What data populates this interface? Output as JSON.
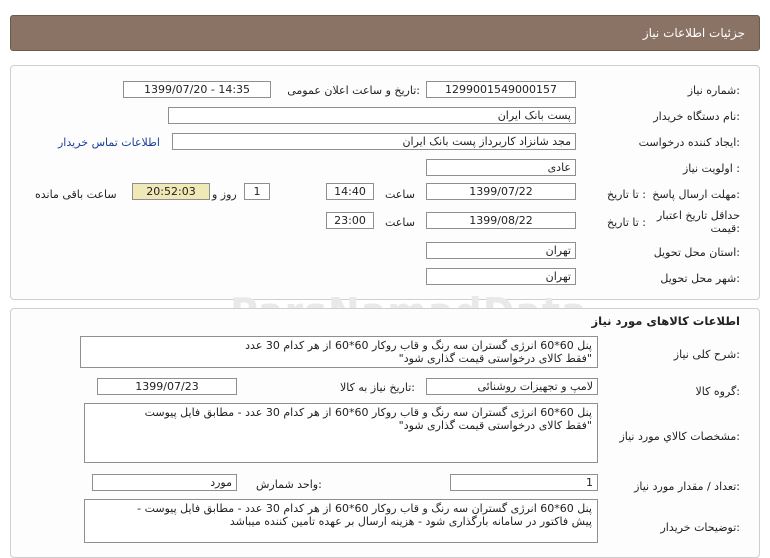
{
  "header": {
    "title": "جزئیات اطلاعات نیاز"
  },
  "watermark": "ParsNamadData",
  "info": {
    "need_number_label": "شماره نیاز:",
    "need_number": "1299001549000157",
    "announce_label": "تاریخ و ساعت اعلان عمومی:",
    "announce_value": "1399/07/20 - 14:35",
    "buyer_org_label": "نام دستگاه خریدار:",
    "buyer_org": "پست بانک ایران",
    "creator_label": "ایجاد کننده درخواست:",
    "creator": "مجد شانزاد کاربرداز پست بانک ایران",
    "contact_link": "اطلاعات تماس خریدار",
    "priority_label": "اولویت نیاز :",
    "priority": "عادی",
    "deadline_label": "مهلت ارسال پاسخ:",
    "until_date_label": "تا تاریخ :",
    "deadline_date": "1399/07/22",
    "time_label": "ساعت",
    "deadline_time": "14:40",
    "days": "1",
    "days_label": "روز و",
    "remaining": "20:52:03",
    "remaining_label": "ساعت باقی مانده",
    "price_valid_label": "حداقل تاریخ اعتبار قیمت:",
    "price_valid_date": "1399/08/22",
    "price_valid_time": "23:00",
    "province_label": "استان محل تحویل:",
    "province": "تهران",
    "city_label": "شهر محل تحویل:",
    "city": "تهران"
  },
  "goods": {
    "title": "اطلاعات کالاهای مورد نیاز",
    "summary_label": "شرح کلی نیاز:",
    "summary_line1": "پنل 60*60 انرژی گستران سه رنگ و قاب روکار 60*60 از هر کدام 30 عدد",
    "summary_line2": "\"فقط کالای درخواستی قیمت گذاری شود\"",
    "group_label": "گروه کالا:",
    "group": "لامپ و تجهیزات روشنائی",
    "need_date_label": "تاریخ نیاز به کالا:",
    "need_date": "1399/07/23",
    "spec_label": "مشخصات کالاي مورد نیاز:",
    "spec_line1": "پنل 60*60 انرژی گستران سه رنگ و قاب روکار 60*60 از هر کدام 30 عدد - مطابق فایل پیوست",
    "spec_line2": "\"فقط کالای درخواستی قیمت گذاری شود\"",
    "qty_label": "تعداد / مقدار مورد نیاز:",
    "qty": "1",
    "unit_label": "واحد شمارش:",
    "unit": "مورد",
    "buyer_notes_label": "توضیحات خریدار:",
    "notes_line1": "پنل 60*60 انرژی گستران سه رنگ و قاب روکار 60*60 از هر کدام 30 عدد - مطابق فایل پیوست -",
    "notes_line2": "پیش فاکتور در سامانه بارگذاری شود - هزینه ارسال بر عهده تامین کننده میباشد"
  }
}
